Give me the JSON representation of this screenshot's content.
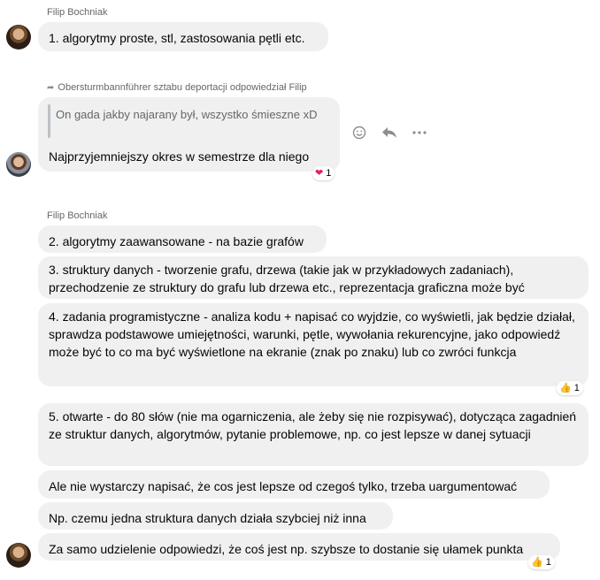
{
  "group1": {
    "sender": "Filip Bochniak",
    "messages": [
      "1. algorytmy proste, stl, zastosowania pętli etc."
    ]
  },
  "reply": {
    "label": "Obersturmbannführer sztabu deportacji odpowiedział Filip",
    "quoted": "On gada jakby najarany był, wszystko śmieszne xD",
    "message": "Najprzyjemniejszy okres w semestrze dla niego",
    "reaction": {
      "emoji": "❤",
      "count": "1"
    }
  },
  "group2": {
    "sender": "Filip Bochniak",
    "messages": [
      "2. algorytmy zaawansowane - na bazie grafów",
      "3. struktury danych - tworzenie grafu, drzewa (takie jak w przykładowych zadaniach), przechodzenie ze struktury do grafu lub drzewa etc., reprezentacja graficzna może być",
      "4. zadania programistyczne - analiza kodu + napisać co wyjdzie, co wyświetli, jak będzie działał, sprawdza podstawowe umiejętności, warunki, pętle, wywołania rekurencyjne, jako odpowiedź może być to co ma być wyświetlone na ekranie (znak po znaku) lub co zwróci funkcja",
      "5. otwarte - do 80 słów (nie ma ogarniczenia, ale żeby się nie rozpisywać), dotycząca zagadnień ze struktur danych, algorytmów, pytanie problemowe, np. co jest lepsze w danej sytuacji",
      "Ale nie wystarczy napisać, że cos jest lepsze od czegoś tylko, trzeba uargumentować",
      "Np. czemu jedna struktura danych działa szybciej niż inna",
      "Za samo udzielenie odpowiedzi, że coś jest np. szybsze to dostanie się ułamek punkta"
    ],
    "reactions": [
      {
        "emoji": "👍",
        "count": "1"
      },
      {
        "emoji": "👍",
        "count": "1"
      }
    ]
  },
  "icons": [
    "emoji-icon",
    "reply-icon",
    "more-icon",
    "reply-arrow-icon"
  ]
}
